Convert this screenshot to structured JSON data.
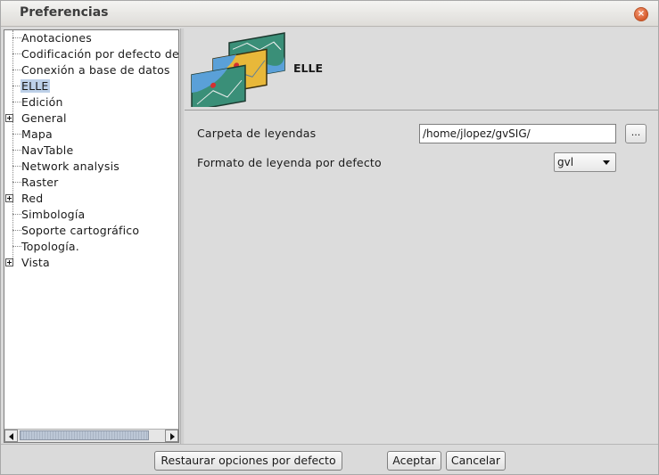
{
  "window": {
    "title": "Preferencias",
    "close_icon": "close-icon"
  },
  "tree": {
    "items": [
      {
        "label": "Anotaciones",
        "expandable": false,
        "selected": false
      },
      {
        "label": "Codificación por defecto del",
        "expandable": false,
        "selected": false
      },
      {
        "label": "Conexión a base de datos",
        "expandable": false,
        "selected": false
      },
      {
        "label": "ELLE",
        "expandable": false,
        "selected": true
      },
      {
        "label": "Edición",
        "expandable": false,
        "selected": false
      },
      {
        "label": "General",
        "expandable": true,
        "selected": false
      },
      {
        "label": "Mapa",
        "expandable": false,
        "selected": false
      },
      {
        "label": "NavTable",
        "expandable": false,
        "selected": false
      },
      {
        "label": "Network analysis",
        "expandable": false,
        "selected": false
      },
      {
        "label": "Raster",
        "expandable": false,
        "selected": false
      },
      {
        "label": "Red",
        "expandable": true,
        "selected": false
      },
      {
        "label": "Simbología",
        "expandable": false,
        "selected": false
      },
      {
        "label": "Soporte cartográfico",
        "expandable": false,
        "selected": false
      },
      {
        "label": "Topología.",
        "expandable": false,
        "selected": false
      },
      {
        "label": "Vista",
        "expandable": true,
        "selected": false
      }
    ]
  },
  "page": {
    "title": "ELLE",
    "icon": "layered-maps-icon",
    "folder_label": "Carpeta de leyendas",
    "folder_value": "/home/jlopez/gvSIG/",
    "browse_label": "...",
    "format_label": "Formato de leyenda por defecto",
    "format_value": "gvl"
  },
  "buttons": {
    "restore": "Restaurar opciones por defecto",
    "accept": "Aceptar",
    "cancel": "Cancelar"
  },
  "colors": {
    "selection": "#bdd0e8",
    "close_button": "#d65b2c"
  }
}
